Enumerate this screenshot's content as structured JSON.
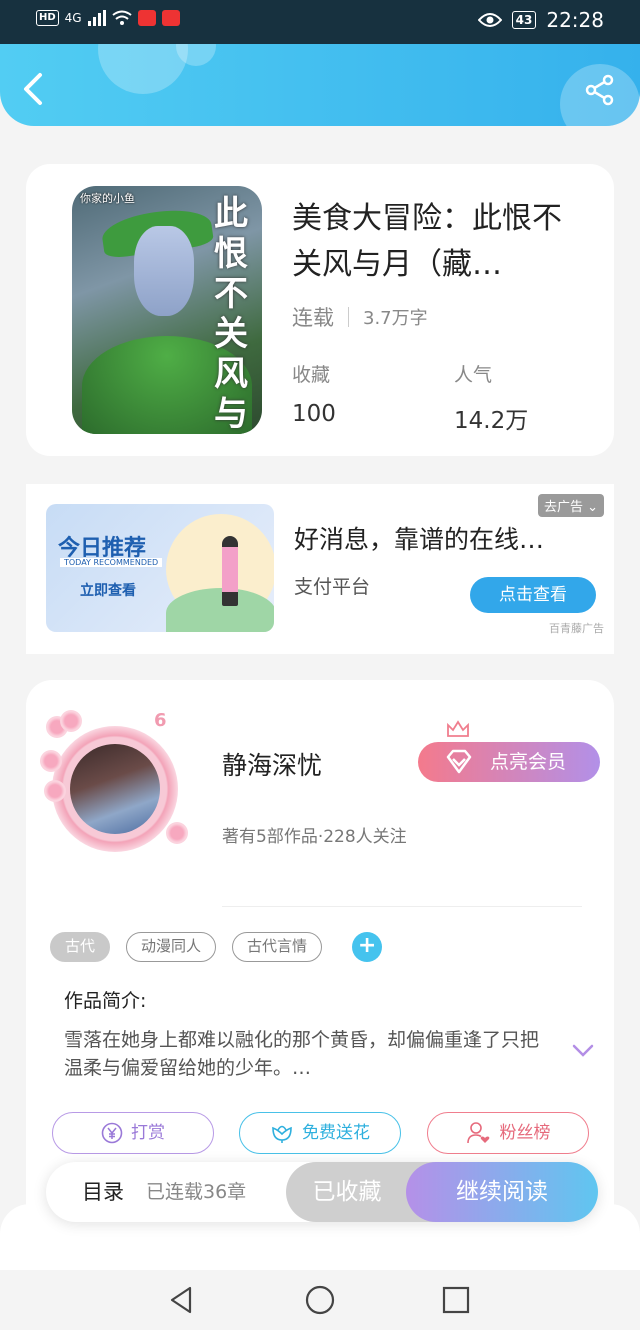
{
  "status_bar": {
    "hd": "HD",
    "network": "4G",
    "battery": "43",
    "time": "22:28"
  },
  "book": {
    "cover_text": "此恨不关风与月",
    "cover_corner": "你家的小鱼",
    "title": "美食大冒险：此恨不关风与月（藏…",
    "status": "连载",
    "word_count": "3.7万字",
    "favorites_label": "收藏",
    "favorites_value": "100",
    "popularity_label": "人气",
    "popularity_value": "14.2万"
  },
  "ad": {
    "image_title": "今日推荐",
    "image_en": "TODAY RECOMMENDED",
    "image_cta": "立即查看",
    "close_label": "去广告",
    "title": "好消息，靠谱的在线…",
    "subtitle": "支付平台",
    "button": "点击查看",
    "source": "百青藤广告"
  },
  "author": {
    "level": "6",
    "name": "静海深忧",
    "vip_button": "点亮会员",
    "stats": "著有5部作品·228人关注",
    "tags": [
      "古代",
      "动漫同人",
      "古代言情"
    ],
    "intro_label": "作品简介:",
    "intro_text": "雪落在她身上都难以融化的那个黄昏，却偏偏重逢了只把温柔与偏爱留给她的少年。…",
    "actions": {
      "reward": "打赏",
      "flower": "免费送花",
      "fans": "粉丝榜"
    }
  },
  "bottom_bar": {
    "toc": "目录",
    "chapters": "已连载36章",
    "collected": "已收藏",
    "read": "继续阅读"
  },
  "colors": {
    "header": "#3fbef0",
    "accent_blue": "#32a7ea",
    "vip_start": "#f47a8c",
    "vip_end": "#b290e8"
  },
  "icons": [
    "back-icon",
    "share-icon",
    "gem-icon",
    "crown-icon",
    "plus-icon",
    "chevron-down-icon",
    "yen-icon",
    "flower-icon",
    "user-heart-icon",
    "nav-back-icon",
    "nav-home-icon",
    "nav-recent-icon"
  ]
}
